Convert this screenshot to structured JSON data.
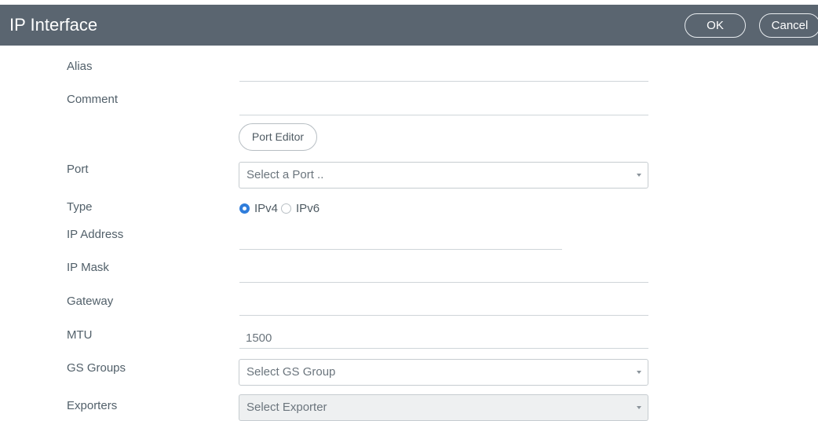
{
  "header": {
    "title": "IP Interface",
    "ok_label": "OK",
    "cancel_label": "Cancel"
  },
  "form": {
    "alias": {
      "label": "Alias",
      "value": ""
    },
    "comment": {
      "label": "Comment",
      "value": ""
    },
    "port_editor_label": "Port Editor",
    "port": {
      "label": "Port",
      "placeholder": "Select a Port .."
    },
    "type": {
      "label": "Type",
      "options": [
        "IPv4",
        "IPv6"
      ],
      "selected": "IPv4"
    },
    "ip_address": {
      "label": "IP Address",
      "value": ""
    },
    "ip_mask": {
      "label": "IP Mask",
      "value": ""
    },
    "gateway": {
      "label": "Gateway",
      "value": ""
    },
    "mtu": {
      "label": "MTU",
      "value": "1500"
    },
    "gs_groups": {
      "label": "GS Groups",
      "placeholder": "Select GS Group"
    },
    "exporters": {
      "label": "Exporters",
      "placeholder": "Select Exporter"
    }
  },
  "colors": {
    "header_bg": "#5a6570",
    "radio_selected": "#2f7ddb"
  },
  "icons": {
    "dropdown": "chevron-down-icon"
  }
}
